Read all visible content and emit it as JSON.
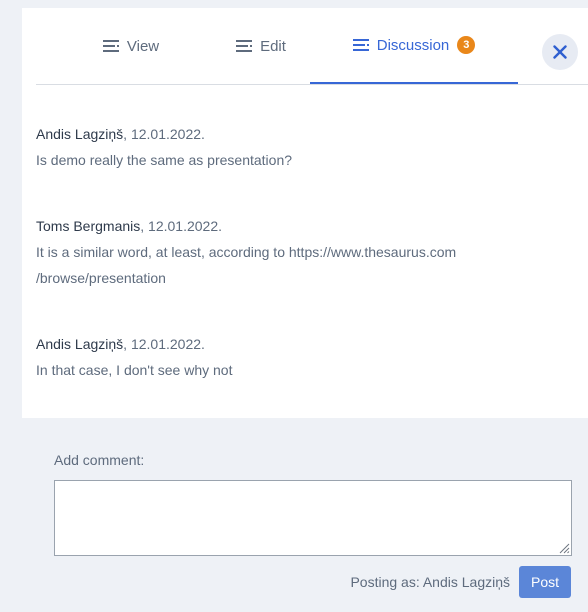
{
  "tabs": [
    {
      "label": "View",
      "icon": "list-lines-icon"
    },
    {
      "label": "Edit",
      "icon": "list-lines-icon"
    },
    {
      "label": "Discussion",
      "icon": "list-lines-icon",
      "badge": "3",
      "active": true
    }
  ],
  "close": {
    "icon": "close-icon"
  },
  "comments": [
    {
      "author": "Andis Lagziņš",
      "date": ", 12.01.2022.",
      "text": "Is demo really the same as presentation?"
    },
    {
      "author": "Toms Bergmanis",
      "date": ", 12.01.2022.",
      "text_line1": "It is a similar word, at least, according to https://www.thesaurus.com",
      "text_line2": "/browse/presentation"
    },
    {
      "author": "Andis Lagziņš",
      "date": ", 12.01.2022.",
      "text": "In that case, I don't see why not"
    }
  ],
  "composer": {
    "label": "Add comment:",
    "value": "",
    "posting_as": "Posting as: Andis Lagziņš",
    "post_label": "Post"
  },
  "colors": {
    "accent": "#3767d6",
    "badge": "#e9871a",
    "post_button": "#5b86d8",
    "background": "#eef1f6"
  }
}
